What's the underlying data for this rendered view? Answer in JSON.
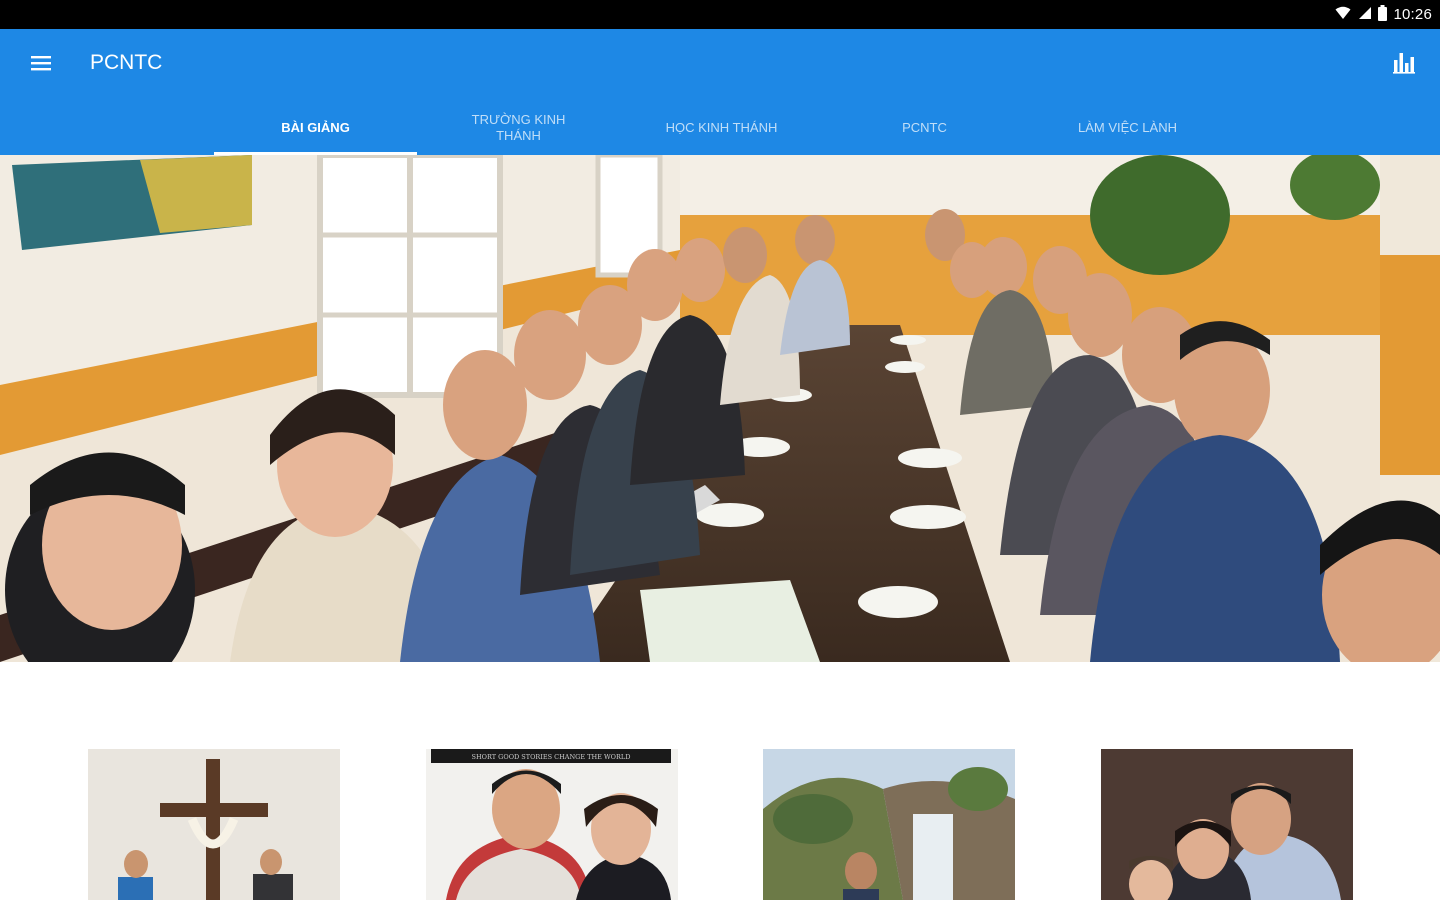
{
  "status_bar": {
    "time": "10:26",
    "icons": [
      "wifi-icon",
      "signal-icon",
      "battery-icon"
    ]
  },
  "app_bar": {
    "title": "PCNTC",
    "menu_icon": "menu-icon",
    "action_icon": "bar-chart-icon",
    "background_color": "#1e88e5"
  },
  "tabs": [
    {
      "label": "BÀI GIẢNG",
      "active": true
    },
    {
      "label": "TRƯỜNG KINH THÁNH",
      "active": false
    },
    {
      "label": "HỌC KINH THÁNH",
      "active": false
    },
    {
      "label": "PCNTC",
      "active": false
    },
    {
      "label": "LÀM VIỆC LÀNH",
      "active": false
    }
  ],
  "hero_image": {
    "caption": "hero photo: group at restaurant table"
  },
  "thumbnails": [
    {
      "name": "cross-photo"
    },
    {
      "name": "couple-photo",
      "banner_text": "SHORT GOOD STORIES CHANGE THE WORLD"
    },
    {
      "name": "waterfall-photo"
    },
    {
      "name": "family-photo"
    }
  ]
}
